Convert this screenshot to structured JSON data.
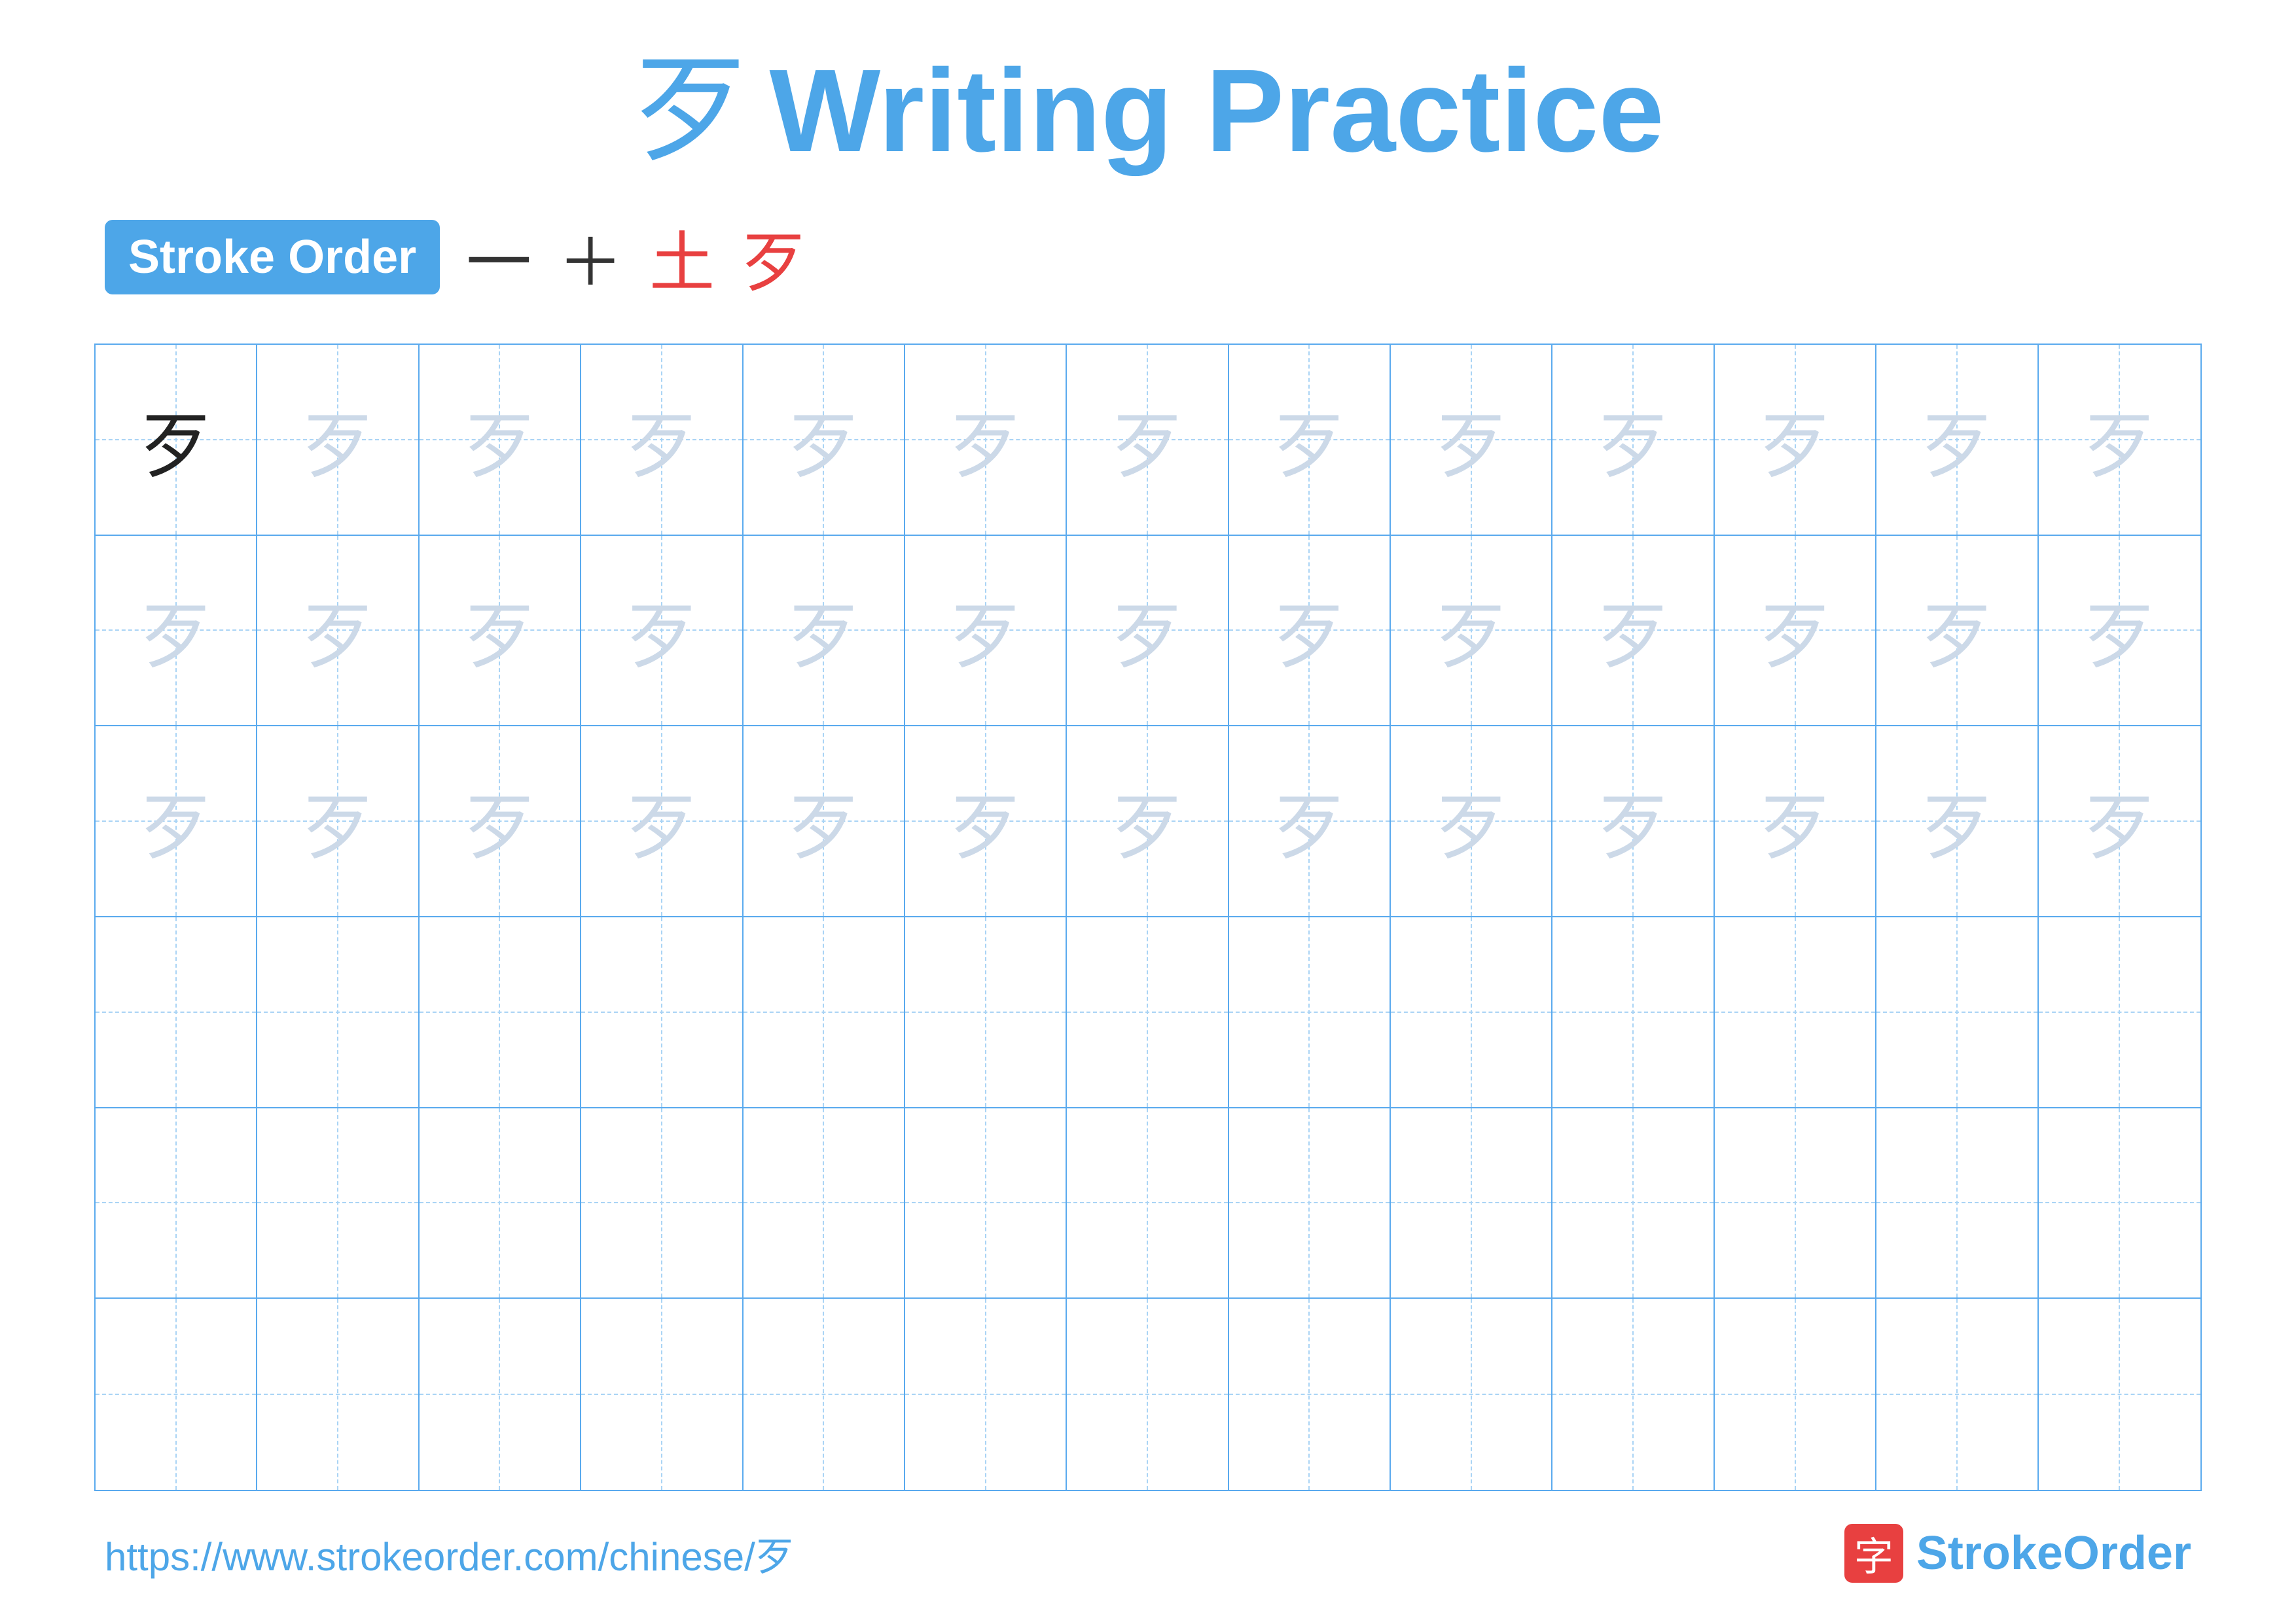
{
  "title": {
    "char": "歹",
    "text": "Writing Practice"
  },
  "stroke_order": {
    "badge_label": "Stroke Order",
    "steps": [
      {
        "char": "一",
        "style": "normal"
      },
      {
        "char": "+",
        "style": "normal"
      },
      {
        "char": "土",
        "style": "red"
      },
      {
        "char": "歹",
        "style": "red"
      }
    ]
  },
  "grid": {
    "rows": 6,
    "cols": 13,
    "chars": [
      [
        "dark",
        "light",
        "light",
        "light",
        "light",
        "light",
        "light",
        "light",
        "light",
        "light",
        "light",
        "light",
        "light"
      ],
      [
        "light",
        "light",
        "light",
        "light",
        "light",
        "light",
        "light",
        "light",
        "light",
        "light",
        "light",
        "light",
        "light"
      ],
      [
        "light",
        "light",
        "light",
        "light",
        "light",
        "light",
        "light",
        "light",
        "light",
        "light",
        "light",
        "light",
        "light"
      ],
      [
        "empty",
        "empty",
        "empty",
        "empty",
        "empty",
        "empty",
        "empty",
        "empty",
        "empty",
        "empty",
        "empty",
        "empty",
        "empty"
      ],
      [
        "empty",
        "empty",
        "empty",
        "empty",
        "empty",
        "empty",
        "empty",
        "empty",
        "empty",
        "empty",
        "empty",
        "empty",
        "empty"
      ],
      [
        "empty",
        "empty",
        "empty",
        "empty",
        "empty",
        "empty",
        "empty",
        "empty",
        "empty",
        "empty",
        "empty",
        "empty",
        "empty"
      ]
    ]
  },
  "footer": {
    "url": "https://www.strokeorder.com/chinese/歹",
    "logo_char": "字",
    "logo_name": "StrokeOrder"
  }
}
